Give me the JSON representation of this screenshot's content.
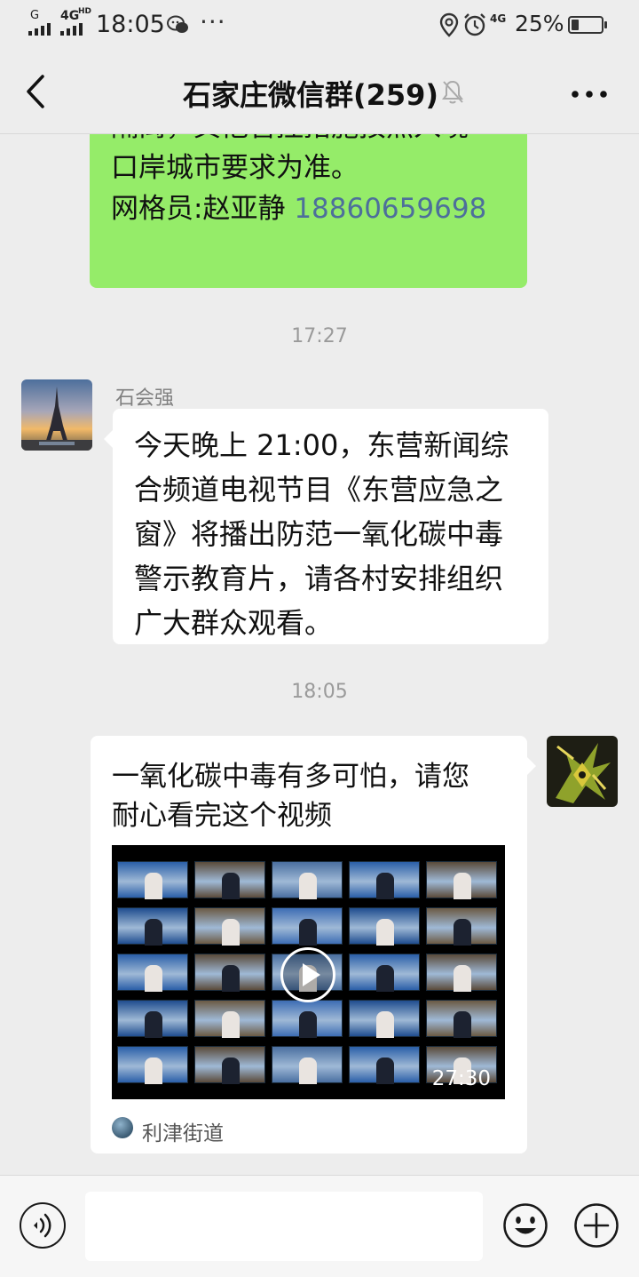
{
  "status_bar": {
    "signal_label_1": "G",
    "signal_label_2": "4G",
    "signal_label_2_sup": "HD",
    "time": "18:05",
    "more": "···",
    "net": "4G",
    "battery_percent": "25%",
    "battery_level": 0.25,
    "icons": [
      "signal-icon",
      "wechat-notification-icon",
      "location-icon",
      "alarm-icon",
      "battery-icon"
    ]
  },
  "header": {
    "back_icon": "chevron-left-icon",
    "title": "石家庄微信群(259)",
    "mute_icon": "bell-muted-icon",
    "more_icon": "more-dots-icon"
  },
  "messages": [
    {
      "type": "text",
      "side": "right",
      "bubble_color": "#95ec69",
      "lines": [
        "隔离，其他管控措施按照入境",
        "口岸城市要求为准。"
      ],
      "contact_prefix": "网格员:赵亚静 ",
      "phone": "18860659698"
    },
    {
      "type": "timestamp",
      "text": "17:27"
    },
    {
      "type": "text",
      "side": "left",
      "sender": "石会强",
      "avatar": "eiffel-tower-avatar",
      "lines": [
        "今天晚上 21:00，东营新闻综",
        "合频道电视节目《东营应急之",
        "窗》将播出防范一氧化碳中毒",
        "警示教育片，请各村安排组织",
        "广大群众观看。"
      ]
    },
    {
      "type": "timestamp",
      "text": "18:05"
    },
    {
      "type": "video-card",
      "side": "right",
      "avatar": "green-robot-avatar",
      "title_lines": [
        "一氧化碳中毒有多可怕，请您",
        "耐心看完这个视频"
      ],
      "duration": "27:30",
      "source": "利津街道",
      "play_icon": "play-icon"
    }
  ],
  "input_bar": {
    "voice_icon": "voice-icon",
    "text_value": "",
    "emoji_icon": "emoji-icon",
    "plus_icon": "plus-icon"
  },
  "colors": {
    "background": "#ededed",
    "green_bubble": "#95ec69",
    "link": "#4d6f9b",
    "timestamp": "#9a9a9a"
  }
}
